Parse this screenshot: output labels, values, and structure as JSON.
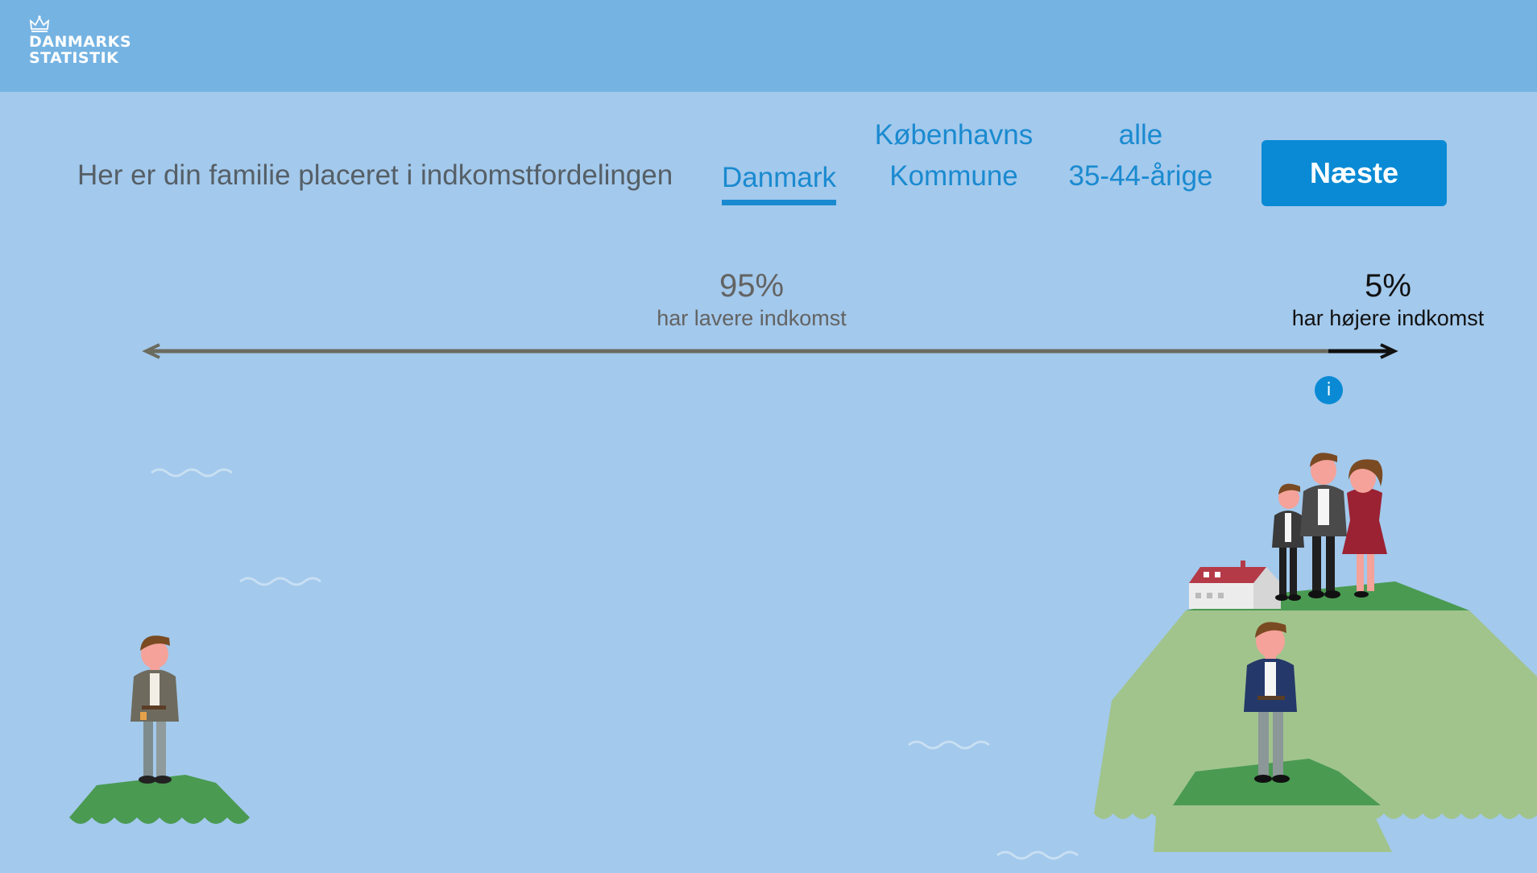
{
  "header": {
    "logo_line1": "DANMARKS",
    "logo_line2": "STATISTIK",
    "logo_icon": "crown-icon"
  },
  "main": {
    "heading": "Her er din familie placeret i indkomstfordelingen",
    "tabs": [
      {
        "label": "Danmark",
        "selected": true
      },
      {
        "label_line1": "Københavns",
        "label_line2": "Kommune",
        "selected": false
      },
      {
        "label_line1": "alle",
        "label_line2": "35-44-årige",
        "selected": false
      }
    ],
    "next_label": "Næste"
  },
  "distribution": {
    "lower": {
      "percent": "95%",
      "label": "har lavere indkomst"
    },
    "higher": {
      "percent": "5%",
      "label": "har højere indkomst"
    },
    "position_fraction": 0.95,
    "info_label": "i"
  },
  "colors": {
    "header_bg": "#75b3e2",
    "page_bg": "#a3c9ec",
    "accent": "#0a8ad4",
    "tab_text": "#1a8ad0"
  }
}
